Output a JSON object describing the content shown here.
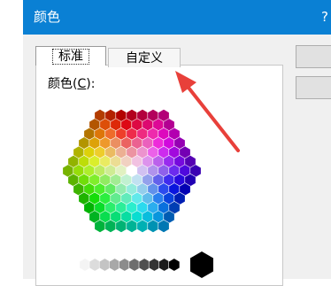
{
  "dialog": {
    "title": "颜色",
    "help_label": "?",
    "accent": "#0a80d4"
  },
  "tabs": [
    {
      "label": "标准",
      "selected": true
    },
    {
      "label": "自定义",
      "selected": false
    }
  ],
  "colors_label": {
    "text": "颜色(",
    "mnemonic": "C",
    "suffix": "):"
  },
  "annotation": {
    "color": "#e8403a",
    "target": "tab-custom"
  }
}
